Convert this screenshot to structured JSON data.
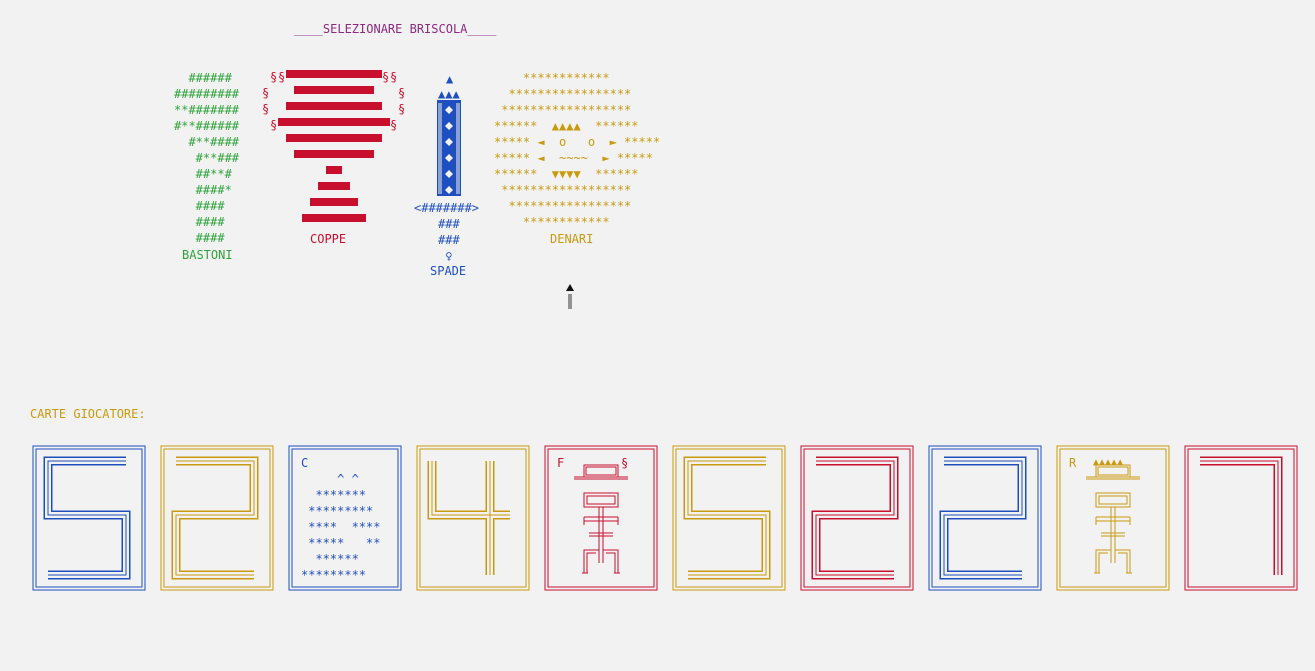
{
  "title": "____SELEZIONARE BRISCOLA____",
  "colors": {
    "bastoni": "#2fa33a",
    "coppe": "#c8102e",
    "spade": "#1f4fbf",
    "denari": "#c99a10",
    "title": "#8c2a84"
  },
  "suits": {
    "bastoni": {
      "label": "BASTONI",
      "art": "  ######\n#########\n**#######\n#**######\n  #**####\n   #**###\n   ##**#\n   ####*\n   ####\n   ####\n   ####"
    },
    "coppe": {
      "label": "COPPE",
      "symbol": "§"
    },
    "spade": {
      "label": "SPADE",
      "top": "▲",
      "crown": "▲▲▲",
      "guard": "<#######>",
      "hilt": "###\n###\n♀"
    },
    "denari": {
      "label": "DENARI",
      "art": "    ************\n  *****************\n ******************\n******  ▲▲▲▲  ******\n***** ◄  o   o  ► *****\n***** ◄  ~~~~  ► *****\n******  ▼▼▼▼  ******\n ******************\n  *****************\n    ************"
    }
  },
  "hand": {
    "label": "CARTE GIOCATORE:",
    "cards": [
      {
        "suit": "spade",
        "rank": "5",
        "color": "#1f4fbf"
      },
      {
        "suit": "denari",
        "rank": "2",
        "color": "#c99a10"
      },
      {
        "suit": "spade",
        "rank": "C",
        "color": "#1f4fbf",
        "art": "C\n     ^ ^\n  *******\n *********\n ****  ****\n *****   **\n  ******\n*********"
      },
      {
        "suit": "denari",
        "rank": "4",
        "color": "#c99a10"
      },
      {
        "suit": "coppe",
        "rank": "F",
        "color": "#c8102e",
        "corner": "F",
        "corner_symbol": "§"
      },
      {
        "suit": "denari",
        "rank": "5",
        "color": "#c99a10"
      },
      {
        "suit": "coppe",
        "rank": "2",
        "color": "#c8102e"
      },
      {
        "suit": "spade",
        "rank": "2",
        "color": "#1f4fbf"
      },
      {
        "suit": "denari",
        "rank": "R",
        "color": "#c99a10",
        "corner": "R",
        "crown": "▲▲▲▲▲"
      },
      {
        "suit": "coppe",
        "rank": "7",
        "color": "#c8102e"
      }
    ]
  }
}
